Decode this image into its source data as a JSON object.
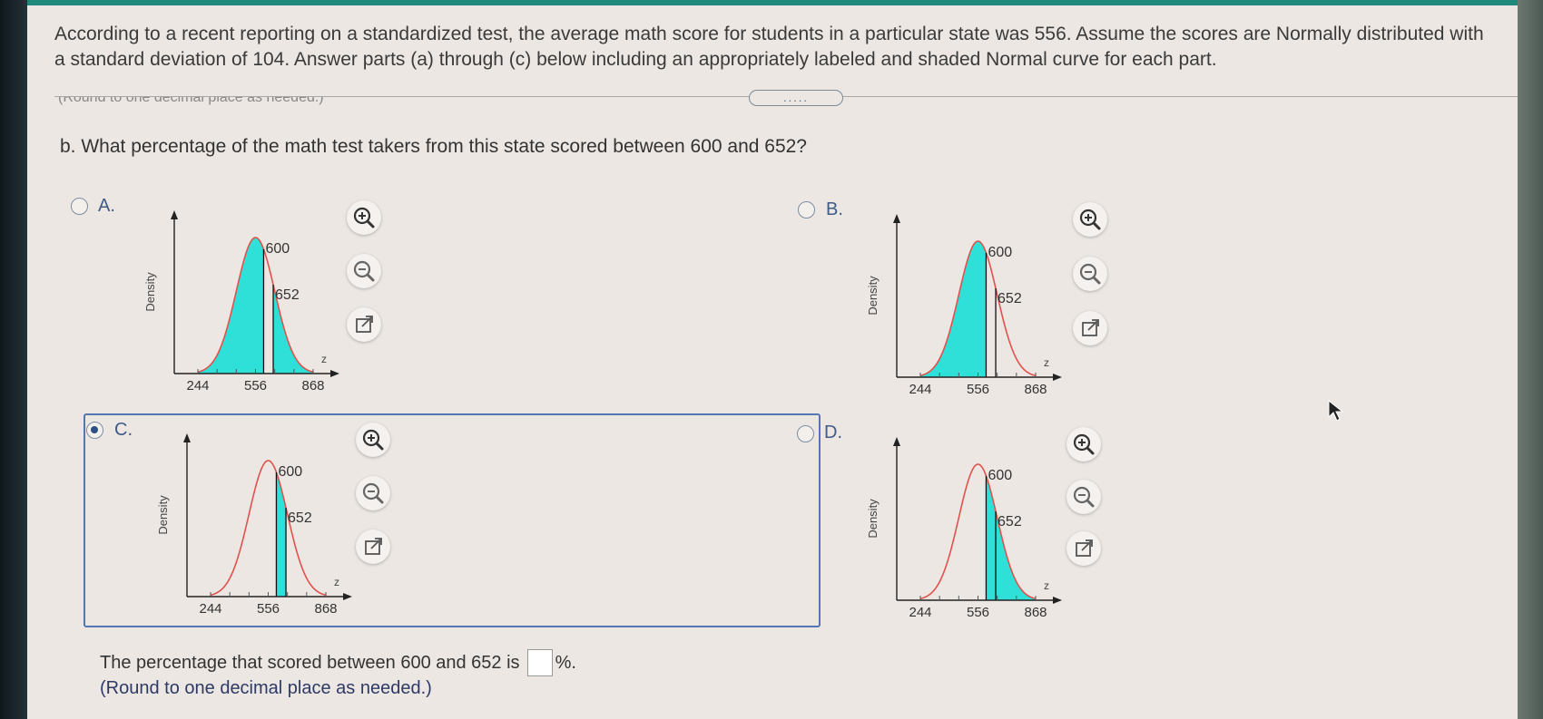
{
  "header": {
    "question_text": "According to a recent reporting on a standardized test, the average math score for students in a particular state was 556. Assume the scores are Normally distributed with a standard deviation of 104. Answer parts (a) through (c) below including an appropriately labeled and shaded Normal curve for each part.",
    "collapse_handle": "....."
  },
  "cropped_hint": "(Round to one decimal place as needed.)",
  "part_b": {
    "question": "b. What percentage of the math test takers from this state scored between 600 and 652?"
  },
  "options": [
    {
      "letter": "A.",
      "selected": false,
      "shading": "below 600 and above 652"
    },
    {
      "letter": "B.",
      "selected": false,
      "shading": "below 600"
    },
    {
      "letter": "C.",
      "selected": true,
      "shading": "between 600 and 652"
    },
    {
      "letter": "D.",
      "selected": false,
      "shading": "above 600"
    }
  ],
  "chart_labels": {
    "ylabel": "Density",
    "xlabel": "z",
    "ticks": [
      "244",
      "556",
      "868"
    ],
    "marker_600": "600",
    "marker_652": "652"
  },
  "answer": {
    "prefix": "The percentage that scored between 600 and 652 is",
    "value": "",
    "suffix": "%.",
    "hint": "(Round to one decimal place as needed.)"
  },
  "tools": [
    "zoom-in-icon",
    "zoom-out-icon",
    "open-external-icon"
  ],
  "colors": {
    "shade": "#2fe0d8",
    "curve": "#e0524e",
    "accent": "#1f8a7b",
    "selection": "#5276b6"
  }
}
